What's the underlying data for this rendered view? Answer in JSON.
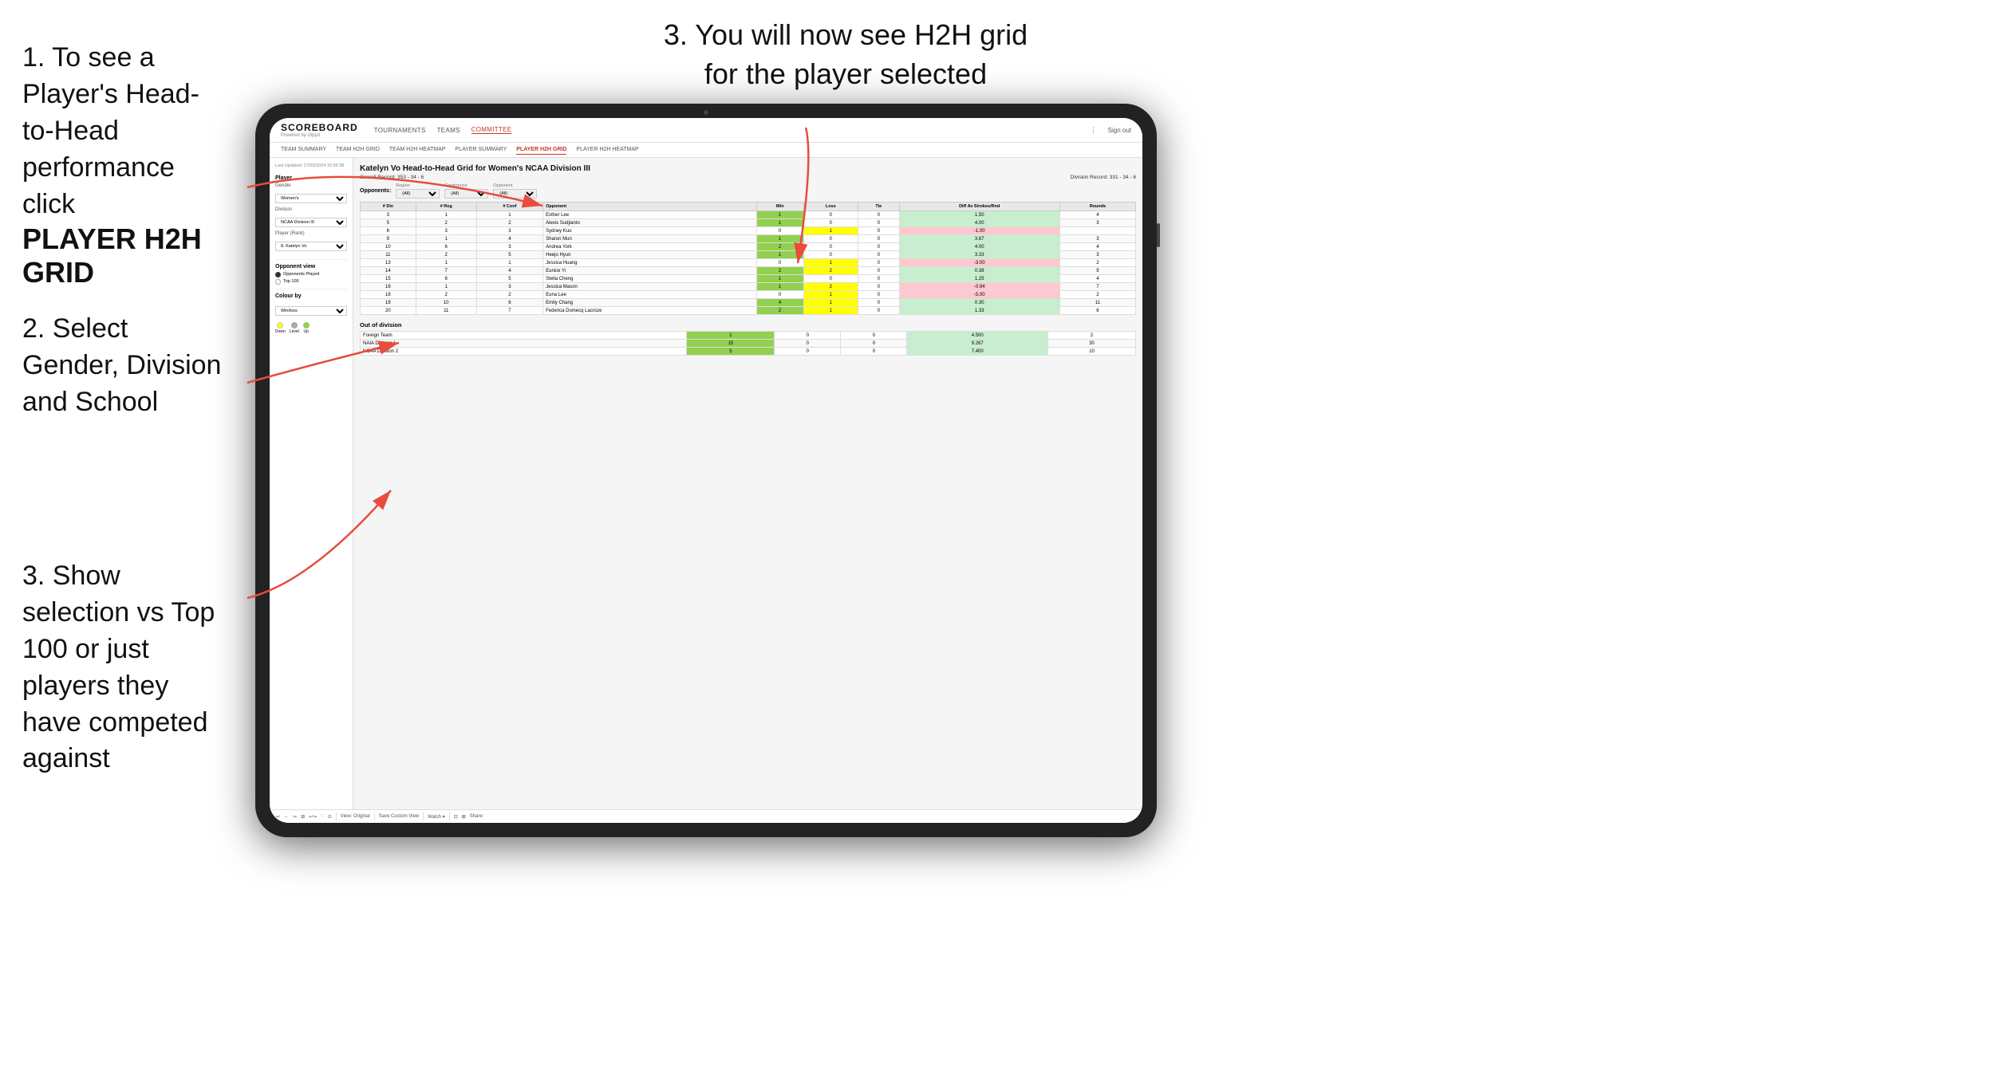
{
  "instructions": {
    "step1_text": "1. To see a Player's Head-to-Head performance click",
    "step1_bold": "PLAYER H2H GRID",
    "step2_text": "2. Select Gender, Division and School",
    "step3_left_text": "3. Show selection vs Top 100 or just players they have competed against",
    "step3_right_text": "3. You will now see H2H grid for the player selected"
  },
  "header": {
    "logo": "SCOREBOARD",
    "logo_sub": "Powered by clippd",
    "nav": [
      "TOURNAMENTS",
      "TEAMS",
      "COMMITTEE"
    ],
    "active_nav": "COMMITTEE",
    "sign_out": "Sign out"
  },
  "sub_nav": {
    "items": [
      "TEAM SUMMARY",
      "TEAM H2H GRID",
      "TEAM H2H HEATMAP",
      "PLAYER SUMMARY",
      "PLAYER H2H GRID",
      "PLAYER H2H HEATMAP"
    ],
    "active": "PLAYER H2H GRID"
  },
  "left_panel": {
    "timestamp": "Last Updated: 27/03/2024 16:55:38",
    "player_section": "Player",
    "gender_label": "Gender",
    "gender_value": "Women's",
    "division_label": "Division",
    "division_value": "NCAA Division III",
    "player_rank_label": "Player (Rank)",
    "player_rank_value": "8. Katelyn Vo",
    "opponent_view_title": "Opponent view",
    "opponent_options": [
      "Opponents Played",
      "Top 100"
    ],
    "opponent_selected": "Opponents Played",
    "colour_by_label": "Colour by",
    "colour_by_value": "Win/loss",
    "legend": [
      {
        "color": "#ffff00",
        "label": "Down"
      },
      {
        "color": "#aaaaaa",
        "label": "Level"
      },
      {
        "color": "#92d050",
        "label": "Up"
      }
    ]
  },
  "grid": {
    "title": "Katelyn Vo Head-to-Head Grid for Women's NCAA Division III",
    "overall_record": "Overall Record: 353 - 34 - 6",
    "division_record": "Division Record: 331 - 34 - 6",
    "filters": {
      "region_label": "Region",
      "region_value": "(All)",
      "conference_label": "Conference",
      "conference_value": "(All)",
      "opponent_label": "Opponent",
      "opponent_value": "(All)",
      "opponents_label": "Opponents:"
    },
    "table_headers": [
      "# Div",
      "# Reg",
      "# Conf",
      "Opponent",
      "Win",
      "Loss",
      "Tie",
      "Diff Av Strokes/Rnd",
      "Rounds"
    ],
    "rows": [
      {
        "div": "3",
        "reg": "1",
        "conf": "1",
        "opponent": "Esther Lee",
        "win": "1",
        "loss": "0",
        "tie": "0",
        "diff": "1.50",
        "rounds": "4",
        "win_color": "green",
        "loss_color": "white",
        "tie_color": "white"
      },
      {
        "div": "5",
        "reg": "2",
        "conf": "2",
        "opponent": "Alexis Sudjianto",
        "win": "1",
        "loss": "0",
        "tie": "0",
        "diff": "4.00",
        "rounds": "3",
        "win_color": "green",
        "loss_color": "white",
        "tie_color": "white"
      },
      {
        "div": "6",
        "reg": "3",
        "conf": "3",
        "opponent": "Sydney Kuo",
        "win": "0",
        "loss": "1",
        "tie": "0",
        "diff": "-1.00",
        "rounds": "",
        "win_color": "white",
        "loss_color": "yellow",
        "tie_color": "white"
      },
      {
        "div": "9",
        "reg": "1",
        "conf": "4",
        "opponent": "Sharon Mun",
        "win": "1",
        "loss": "0",
        "tie": "0",
        "diff": "3.67",
        "rounds": "3",
        "win_color": "green",
        "loss_color": "white",
        "tie_color": "white"
      },
      {
        "div": "10",
        "reg": "6",
        "conf": "3",
        "opponent": "Andrea York",
        "win": "2",
        "loss": "0",
        "tie": "0",
        "diff": "4.00",
        "rounds": "4",
        "win_color": "green",
        "loss_color": "white",
        "tie_color": "white"
      },
      {
        "div": "11",
        "reg": "2",
        "conf": "5",
        "opponent": "Heejo Hyun",
        "win": "1",
        "loss": "0",
        "tie": "0",
        "diff": "3.33",
        "rounds": "3",
        "win_color": "green",
        "loss_color": "white",
        "tie_color": "white"
      },
      {
        "div": "13",
        "reg": "1",
        "conf": "1",
        "opponent": "Jessica Huang",
        "win": "0",
        "loss": "1",
        "tie": "0",
        "diff": "-3.00",
        "rounds": "2",
        "win_color": "white",
        "loss_color": "yellow",
        "tie_color": "white"
      },
      {
        "div": "14",
        "reg": "7",
        "conf": "4",
        "opponent": "Eunice Yi",
        "win": "2",
        "loss": "2",
        "tie": "0",
        "diff": "0.38",
        "rounds": "9",
        "win_color": "green",
        "loss_color": "yellow",
        "tie_color": "white"
      },
      {
        "div": "15",
        "reg": "8",
        "conf": "5",
        "opponent": "Stella Cheng",
        "win": "1",
        "loss": "0",
        "tie": "0",
        "diff": "1.25",
        "rounds": "4",
        "win_color": "green",
        "loss_color": "white",
        "tie_color": "white"
      },
      {
        "div": "16",
        "reg": "1",
        "conf": "3",
        "opponent": "Jessica Mason",
        "win": "1",
        "loss": "2",
        "tie": "0",
        "diff": "-0.94",
        "rounds": "7",
        "win_color": "green",
        "loss_color": "yellow",
        "tie_color": "white"
      },
      {
        "div": "18",
        "reg": "2",
        "conf": "2",
        "opponent": "Euna Lee",
        "win": "0",
        "loss": "1",
        "tie": "0",
        "diff": "-5.00",
        "rounds": "2",
        "win_color": "white",
        "loss_color": "yellow",
        "tie_color": "white"
      },
      {
        "div": "19",
        "reg": "10",
        "conf": "6",
        "opponent": "Emily Chang",
        "win": "4",
        "loss": "1",
        "tie": "0",
        "diff": "0.30",
        "rounds": "11",
        "win_color": "green",
        "loss_color": "yellow",
        "tie_color": "white"
      },
      {
        "div": "20",
        "reg": "11",
        "conf": "7",
        "opponent": "Federica Domecq Lacroze",
        "win": "2",
        "loss": "1",
        "tie": "0",
        "diff": "1.33",
        "rounds": "6",
        "win_color": "green",
        "loss_color": "yellow",
        "tie_color": "white"
      }
    ],
    "out_of_division_label": "Out of division",
    "out_of_division_rows": [
      {
        "opponent": "Foreign Team",
        "win": "1",
        "loss": "0",
        "tie": "0",
        "diff": "4.500",
        "rounds": "2"
      },
      {
        "opponent": "NAIA Division 1",
        "win": "15",
        "loss": "0",
        "tie": "0",
        "diff": "9.267",
        "rounds": "30"
      },
      {
        "opponent": "NCAA Division 2",
        "win": "5",
        "loss": "0",
        "tie": "0",
        "diff": "7.400",
        "rounds": "10"
      }
    ]
  },
  "toolbar": {
    "buttons": [
      "↩",
      "←",
      "↪",
      "⊞",
      "↩↪",
      "◌",
      "⊙",
      "View: Original",
      "Save Custom View",
      "Watch ▾",
      "⊡",
      "⊠",
      "Share"
    ]
  }
}
